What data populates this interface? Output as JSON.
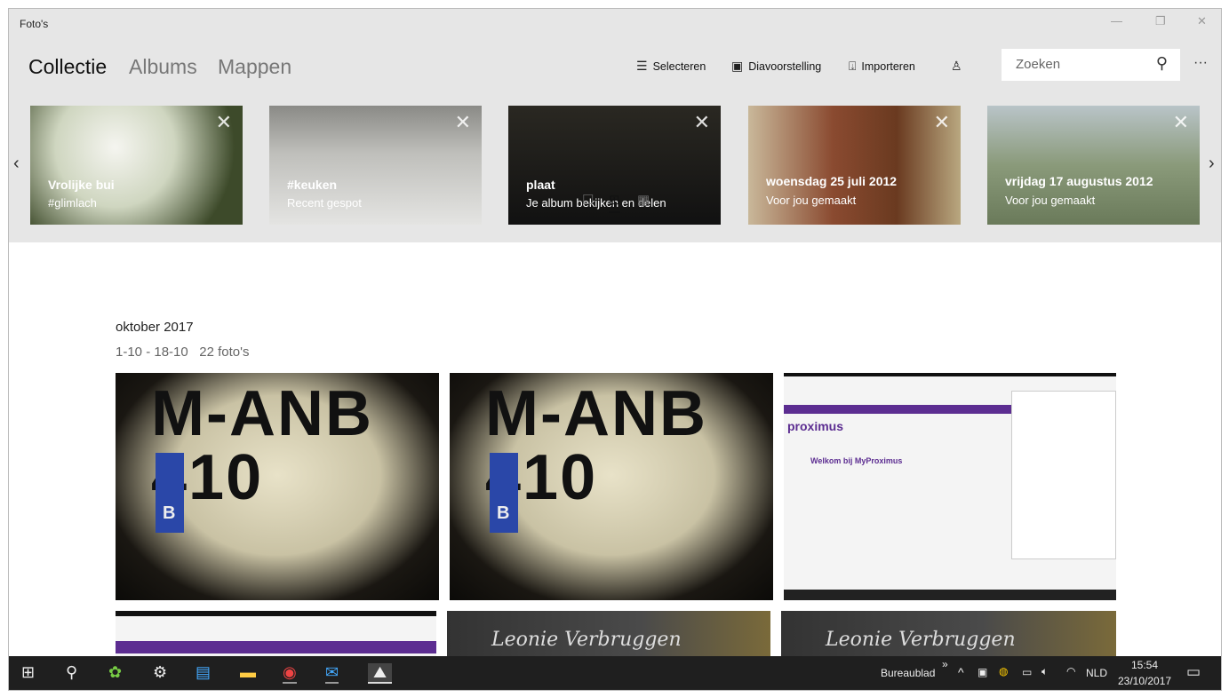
{
  "app_title": "Foto's",
  "tabs": [
    "Collectie",
    "Albums",
    "Mappen"
  ],
  "commands": {
    "select": "Selecteren",
    "slideshow": "Diavoorstelling",
    "import": "Importeren"
  },
  "search": {
    "placeholder": "Zoeken"
  },
  "more": "···",
  "cards": [
    {
      "title": "Vrolijke bui",
      "subtitle": "#glimlach"
    },
    {
      "title": "#keuken",
      "subtitle": "Recent gespot"
    },
    {
      "title": "plaat",
      "subtitle": "Je album bekijken en delen"
    },
    {
      "title": "woensdag 25 juli 2012",
      "subtitle": "Voor jou gemaakt"
    },
    {
      "title": "vrijdag 17 augustus 2012",
      "subtitle": "Voor jou gemaakt"
    }
  ],
  "section": {
    "month": "oktober 2017",
    "range": "1-10 - 18-10",
    "count": "22 foto's"
  },
  "photo_text": {
    "plate": "M-ANB\n410",
    "plate_country": "B",
    "site": "proximus",
    "site_title": "Welkom bij MyProximus",
    "grave": "Leonie Verbruggen"
  },
  "taskbar": {
    "desktop": "Bureaublad",
    "lang": "NLD",
    "time": "15:54",
    "date": "23/10/2017"
  }
}
